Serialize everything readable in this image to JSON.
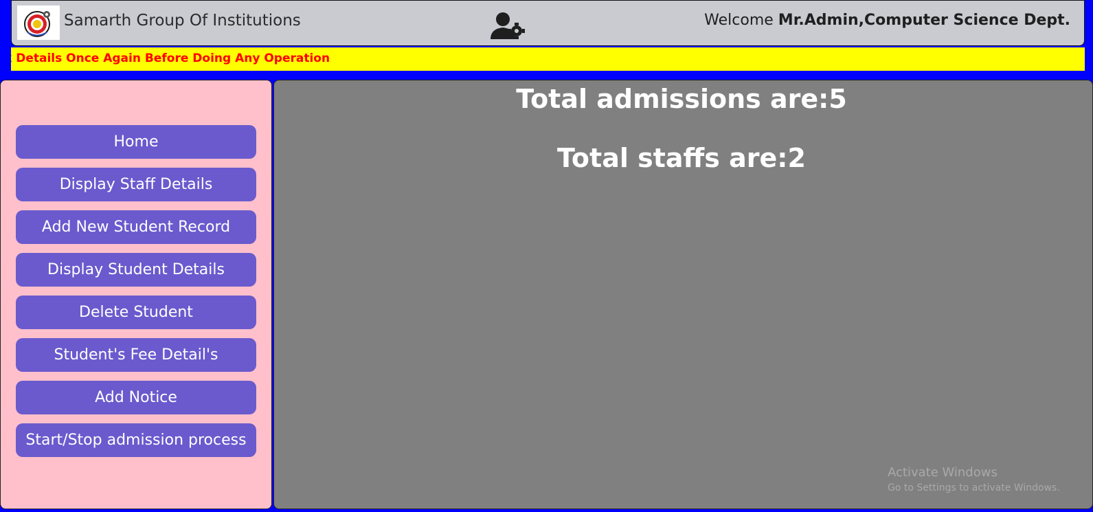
{
  "header": {
    "brand": "Samarth Group Of Institutions",
    "welcome_prefix": "Welcome ",
    "welcome_user": "Mr.Admin,Computer Science Dept."
  },
  "ticker": {
    "text": "k Details Once Again Before Doing Any Operation"
  },
  "sidebar": {
    "items": [
      {
        "label": "Home"
      },
      {
        "label": "Display Staff Details"
      },
      {
        "label": "Add New Student Record"
      },
      {
        "label": "Display Student Details"
      },
      {
        "label": "Delete Student"
      },
      {
        "label": "Student's Fee Detail's"
      },
      {
        "label": "Add Notice"
      },
      {
        "label": "Start/Stop admission process"
      }
    ]
  },
  "main": {
    "admissions_text": "Total admissions are:5",
    "staffs_text": "Total staffs are:2"
  },
  "watermark": {
    "title": "Activate Windows",
    "subtitle": "Go to Settings to activate Windows."
  },
  "icons": {
    "logo": "institution-logo-icon",
    "admin": "user-gear-icon"
  },
  "colors": {
    "background": "#0000ff",
    "header_bg": "#c9cbd1",
    "ticker_bg": "#ffff00",
    "ticker_text": "#ff0000",
    "sidebar_bg": "#ffc0cb",
    "button_bg": "#6a5acd",
    "main_bg": "#808080"
  }
}
